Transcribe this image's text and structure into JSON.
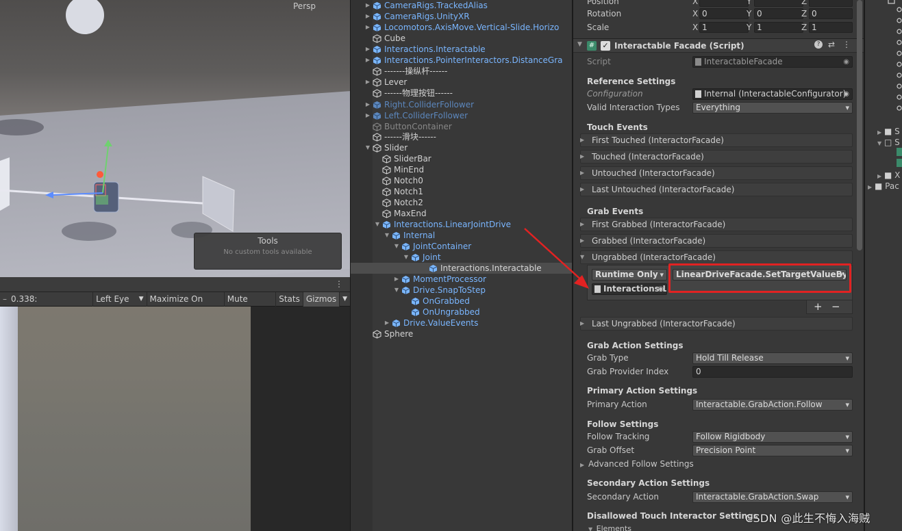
{
  "scene": {
    "persp_label": "Persp",
    "tools_title": "Tools",
    "tools_subtitle": "No custom tools available"
  },
  "gamebar": {
    "scale_value": "0.338:",
    "display": "Left Eye",
    "maximize": "Maximize On Play",
    "mute": "Mute Audio",
    "stats": "Stats",
    "gizmos": "Gizmos"
  },
  "hierarchy": {
    "items": [
      {
        "label": "CameraRigs.TrackedAlias",
        "kind": "prefab"
      },
      {
        "label": "CameraRigs.UnityXR",
        "kind": "prefab"
      },
      {
        "label": "Locomotors.AxisMove.Vertical-Slide.Horizo",
        "kind": "prefab"
      },
      {
        "label": "Cube",
        "kind": "object"
      },
      {
        "label": "Interactions.Interactable",
        "kind": "prefab"
      },
      {
        "label": "Interactions.PointerInteractors.DistanceGra",
        "kind": "prefab"
      },
      {
        "label": "-------操纵杆------",
        "kind": "object"
      },
      {
        "label": "Lever",
        "kind": "object"
      },
      {
        "label": "------物理按钮------",
        "kind": "object"
      },
      {
        "label": "Right.ColliderFollower",
        "kind": "prefab-disabled"
      },
      {
        "label": "Left.ColliderFollower",
        "kind": "prefab-disabled"
      },
      {
        "label": "ButtonContainer",
        "kind": "disabled"
      },
      {
        "label": "------滑块------",
        "kind": "object"
      },
      {
        "label": "Slider",
        "kind": "object"
      },
      {
        "label": "SliderBar",
        "kind": "object"
      },
      {
        "label": "MinEnd",
        "kind": "object"
      },
      {
        "label": "Notch0",
        "kind": "object"
      },
      {
        "label": "Notch1",
        "kind": "object"
      },
      {
        "label": "Notch2",
        "kind": "object"
      },
      {
        "label": "MaxEnd",
        "kind": "object"
      },
      {
        "label": "Interactions.LinearJointDrive",
        "kind": "prefab"
      },
      {
        "label": "Internal",
        "kind": "prefab"
      },
      {
        "label": "JointContainer",
        "kind": "prefab"
      },
      {
        "label": "Joint",
        "kind": "prefab"
      },
      {
        "label": "Interactions.Interactable",
        "kind": "prefab-selected"
      },
      {
        "label": "MomentProcessor",
        "kind": "prefab"
      },
      {
        "label": "Drive.SnapToStep",
        "kind": "prefab"
      },
      {
        "label": "OnGrabbed",
        "kind": "prefab"
      },
      {
        "label": "OnUngrabbed",
        "kind": "prefab"
      },
      {
        "label": "Drive.ValueEvents",
        "kind": "prefab"
      },
      {
        "label": "Sphere",
        "kind": "object"
      }
    ]
  },
  "inspector": {
    "transform": {
      "position_label": "Position",
      "rotation_label": "Rotation",
      "scale_label": "Scale",
      "rotation": {
        "x": "0",
        "y": "0",
        "z": "0"
      },
      "scale": {
        "x": "1",
        "y": "1",
        "z": "1"
      }
    },
    "component_title": "Interactable Facade (Script)",
    "script_label": "Script",
    "script_value": "InteractableFacade",
    "reference_settings": "Reference Settings",
    "configuration_label": "Configuration",
    "configuration_value": "Internal (InteractableConfigurator)",
    "valid_types_label": "Valid Interaction Types",
    "valid_types_value": "Everything",
    "touch_events": "Touch Events",
    "touch_items": [
      "First Touched (InteractorFacade)",
      "Touched (InteractorFacade)",
      "Untouched (InteractorFacade)",
      "Last Untouched (InteractorFacade)"
    ],
    "grab_events": "Grab Events",
    "grab_items": [
      "First Grabbed (InteractorFacade)",
      "Grabbed (InteractorFacade)",
      "Ungrabbed (InteractorFacade)"
    ],
    "runtime_value": "Runtime Only",
    "function_value": "LinearDriveFacade.SetTargetValueBySte",
    "target_object": "Interactions.L",
    "plus": "+",
    "minus": "−",
    "last_ungrabbed": "Last Ungrabbed (InteractorFacade)",
    "grab_action_settings": "Grab Action Settings",
    "grab_type_label": "Grab Type",
    "grab_type_value": "Hold Till Release",
    "grab_provider_label": "Grab Provider Index",
    "grab_provider_value": "0",
    "primary_action_settings": "Primary Action Settings",
    "primary_action_label": "Primary Action",
    "primary_action_value": "Interactable.GrabAction.Follow",
    "follow_settings": "Follow Settings",
    "follow_tracking_label": "Follow Tracking",
    "follow_tracking_value": "Follow Rigidbody",
    "grab_offset_label": "Grab Offset",
    "grab_offset_value": "Precision Point",
    "advanced_follow": "Advanced Follow Settings",
    "secondary_action_settings": "Secondary Action Settings",
    "secondary_action_label": "Secondary Action",
    "secondary_action_value": "Interactable.GrabAction.Swap",
    "disallowed": "Disallowed Touch Interactor Settings",
    "elements": "Elements"
  },
  "project": {
    "items": [
      "S",
      "S",
      "X",
      "Pac"
    ]
  },
  "watermark": "CSDN @此生不悔入海贼",
  "colors": {
    "prefab_blue": "#7ab6ff",
    "highlight_red": "#e22222",
    "panel": "#383838"
  }
}
